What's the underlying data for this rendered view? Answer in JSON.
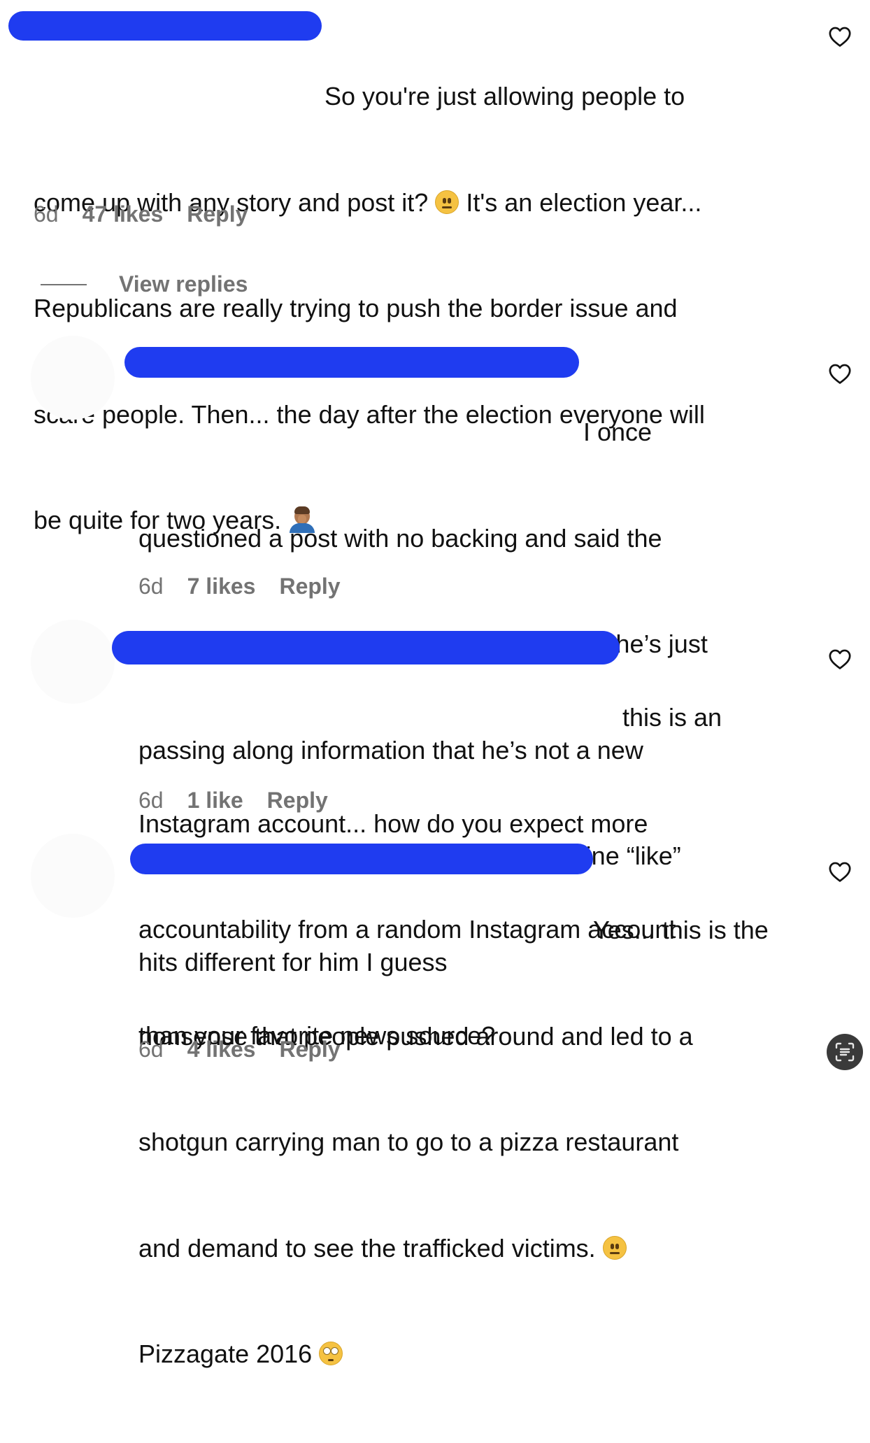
{
  "comments": [
    {
      "lines": [
        "So you're just allowing people to",
        "come up with any story and post it?",
        "It's an election year...",
        "Republicans are really trying to push the border issue and",
        "scare people. Then... the day after the election everyone will",
        "be quite for two years."
      ],
      "time": "6d",
      "likes": "47 likes",
      "reply": "Reply"
    },
    {
      "lines": [
        "I once",
        "questioned a post with no backing and said the",
        "same thing and dude legit wrote back how he’s just",
        "passing along information that he’s not a new",
        "source but yet claims to be. That dopamine “like”",
        "hits different for him I guess"
      ],
      "time": "6d",
      "likes": "7 likes",
      "reply": "Reply"
    },
    {
      "lines": [
        "this is an",
        "Instagram account... how do you expect more",
        "accountability from a random Instagram account",
        "than your favorite news source?"
      ],
      "time": "6d",
      "likes": "1 like",
      "reply": "Reply"
    },
    {
      "lines": [
        "Yes... this is the",
        "nonsense that people pushed around and led to a",
        "shotgun carrying man to go to a pizza restaurant",
        "and demand to see the trafficked victims.",
        "Pizzagate 2016"
      ],
      "time": "6d",
      "likes": "4 likes",
      "reply": "Reply"
    }
  ],
  "view_replies_label": "View replies",
  "icons": {
    "like": "heart-outline-icon",
    "fab": "text-scan-icon",
    "neutral": "neutral-face-emoji",
    "facepalm": "person-facepalming-emoji",
    "eyeroll": "face-with-rolling-eyes-emoji"
  },
  "colors": {
    "redaction": "#1f3cf0",
    "meta_text": "#737373",
    "body_text": "#111111"
  }
}
